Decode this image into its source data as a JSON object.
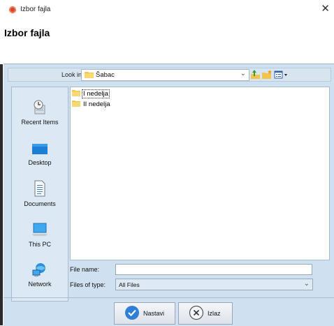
{
  "window": {
    "title": "Izbor fajla",
    "heading": "Izbor fajla"
  },
  "lookin": {
    "label": "Look in:",
    "value": "Šabac"
  },
  "sidebar": {
    "items": [
      {
        "label": "Recent Items",
        "icon": "recent-items-icon"
      },
      {
        "label": "Desktop",
        "icon": "desktop-icon"
      },
      {
        "label": "Documents",
        "icon": "documents-icon"
      },
      {
        "label": "This PC",
        "icon": "this-pc-icon"
      },
      {
        "label": "Network",
        "icon": "network-icon"
      }
    ]
  },
  "files": [
    {
      "name": "I nedelja",
      "focused": true
    },
    {
      "name": "II nedelja",
      "focused": false
    }
  ],
  "form": {
    "file_name_label": "File name:",
    "file_name_value": "",
    "file_type_label": "Files of type:",
    "file_type_value": "All Files"
  },
  "buttons": {
    "ok_label": "Nastavi",
    "cancel_label": "Izlaz"
  },
  "colors": {
    "panel": "#cfe0f0",
    "ok_icon": "#2f7fd6"
  }
}
